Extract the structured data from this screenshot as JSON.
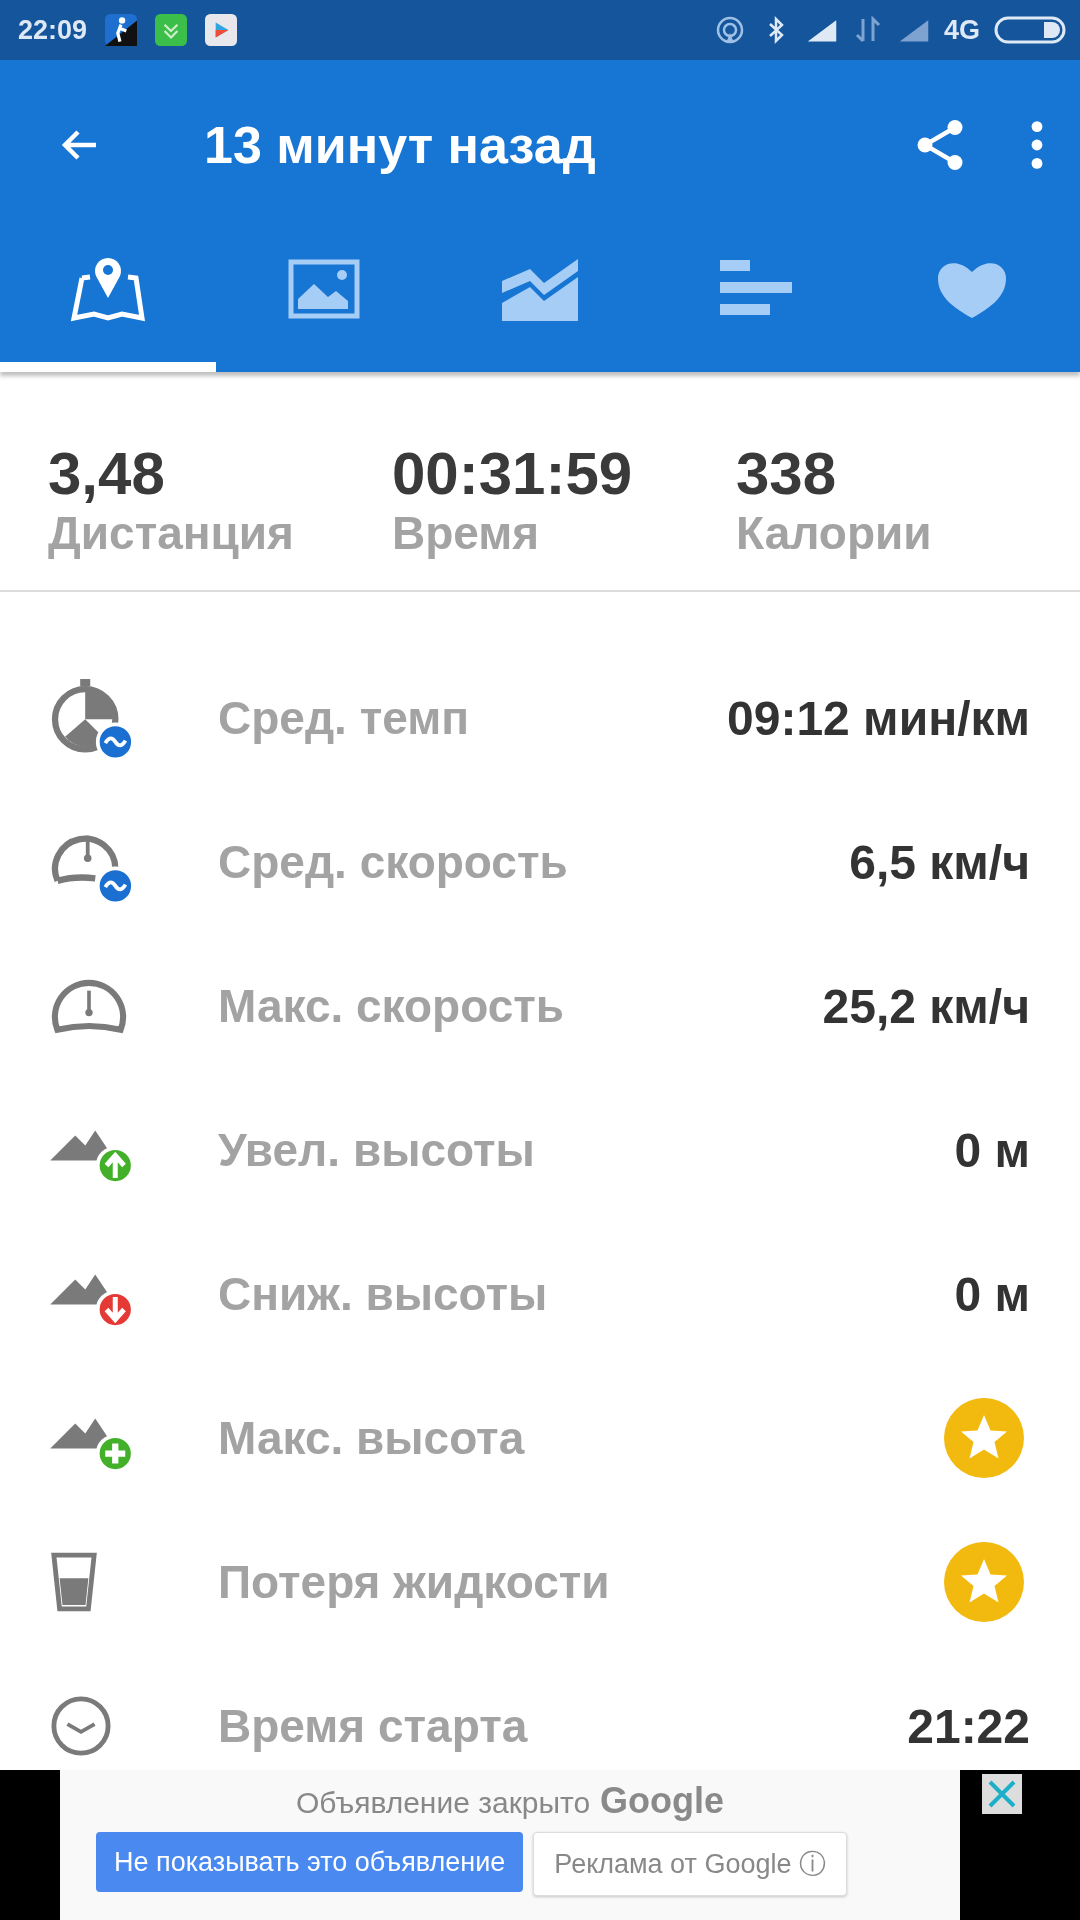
{
  "status_bar": {
    "time": "22:09",
    "network": "4G"
  },
  "app_bar": {
    "title": "13 минут назад"
  },
  "tabs": [
    {
      "kind": "map",
      "selected": true
    },
    {
      "kind": "photo",
      "selected": false
    },
    {
      "kind": "chart",
      "selected": false
    },
    {
      "kind": "bars",
      "selected": false
    },
    {
      "kind": "heart",
      "selected": false
    }
  ],
  "summary": [
    {
      "value": "3,48",
      "label": "Дистанция"
    },
    {
      "value": "00:31:59",
      "label": "Время"
    },
    {
      "value": "338",
      "label": "Калории"
    }
  ],
  "stats": [
    {
      "kind": "pace",
      "label": "Сред. темп",
      "premium": false,
      "value": "09:12 мин/км"
    },
    {
      "kind": "avgspeed",
      "label": "Сред. скорость",
      "premium": false,
      "value": "6,5 км/ч"
    },
    {
      "kind": "maxspeed",
      "label": "Макс. скорость",
      "premium": false,
      "value": "25,2 км/ч"
    },
    {
      "kind": "ascent",
      "label": "Увел. высоты",
      "premium": false,
      "value": "0 м"
    },
    {
      "kind": "descent",
      "label": "Сниж. высоты",
      "premium": false,
      "value": "0 м"
    },
    {
      "kind": "altitude",
      "label": "Макс. высота",
      "premium": true
    },
    {
      "kind": "fluid",
      "label": "Потеря жидкости",
      "premium": true
    },
    {
      "kind": "clock",
      "label": "Время старта",
      "premium": false,
      "value": "21:22"
    }
  ],
  "ad": {
    "message": "Объявление закрыто",
    "brand": "Google",
    "hide_button": "Не показывать это объявление",
    "info_button": "Реклама от Google",
    "info_icon": "ⓘ"
  }
}
